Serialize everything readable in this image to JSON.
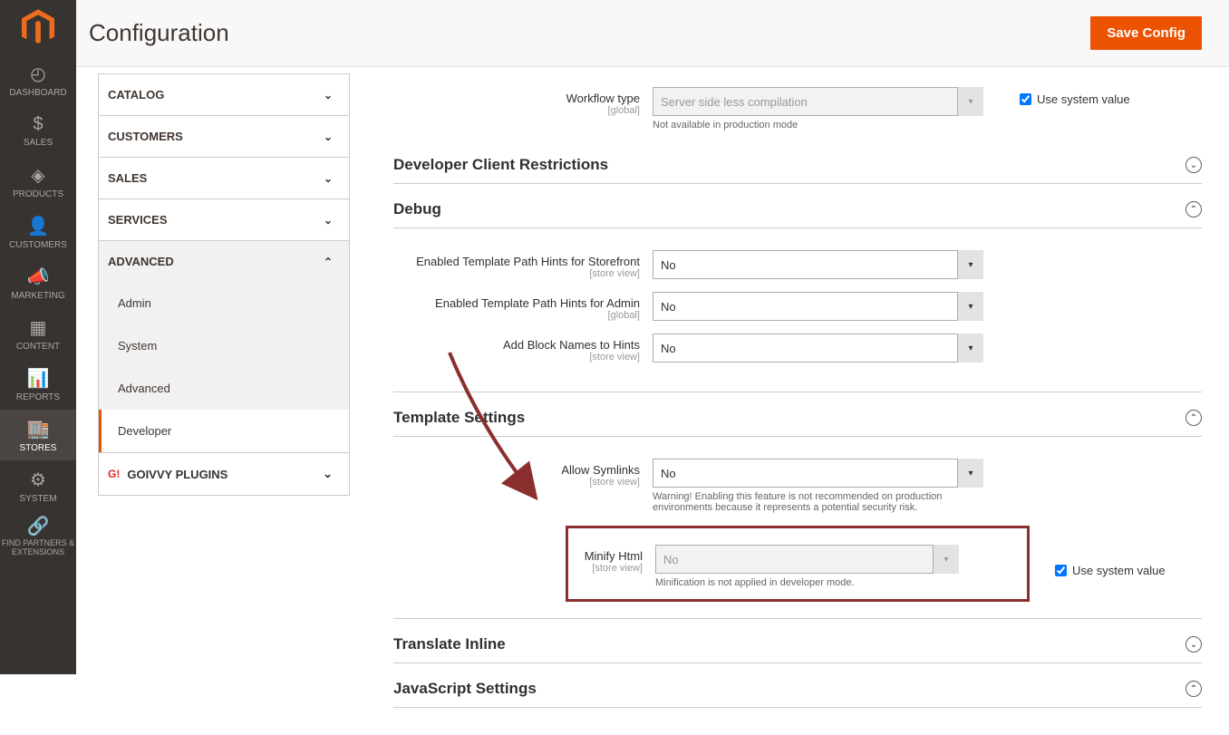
{
  "page": {
    "title": "Configuration",
    "save_button": "Save Config"
  },
  "sidebar": {
    "items": [
      {
        "label": "DASHBOARD"
      },
      {
        "label": "SALES"
      },
      {
        "label": "PRODUCTS"
      },
      {
        "label": "CUSTOMERS"
      },
      {
        "label": "MARKETING"
      },
      {
        "label": "CONTENT"
      },
      {
        "label": "REPORTS"
      },
      {
        "label": "STORES"
      },
      {
        "label": "SYSTEM"
      },
      {
        "label": "FIND PARTNERS & EXTENSIONS"
      }
    ]
  },
  "tabs": {
    "groups": [
      {
        "label": "CATALOG"
      },
      {
        "label": "CUSTOMERS"
      },
      {
        "label": "SALES"
      },
      {
        "label": "SERVICES"
      },
      {
        "label": "ADVANCED",
        "expanded": true,
        "items": [
          {
            "label": "Admin"
          },
          {
            "label": "System"
          },
          {
            "label": "Advanced"
          },
          {
            "label": "Developer",
            "active": true
          }
        ]
      },
      {
        "label": "GOIVVY PLUGINS",
        "plugins": true
      }
    ]
  },
  "workflow": {
    "label": "Workflow type",
    "scope": "[global]",
    "value": "Server side less compilation",
    "note": "Not available in production mode",
    "use_system": "Use system value"
  },
  "sections": {
    "client_restrictions": {
      "title": "Developer Client Restrictions"
    },
    "debug": {
      "title": "Debug",
      "fields": [
        {
          "label": "Enabled Template Path Hints for Storefront",
          "scope": "[store view]",
          "value": "No"
        },
        {
          "label": "Enabled Template Path Hints for Admin",
          "scope": "[global]",
          "value": "No"
        },
        {
          "label": "Add Block Names to Hints",
          "scope": "[store view]",
          "value": "No"
        }
      ]
    },
    "template": {
      "title": "Template Settings",
      "fields": [
        {
          "label": "Allow Symlinks",
          "scope": "[store view]",
          "value": "No",
          "note": "Warning! Enabling this feature is not recommended on production environments because it represents a potential security risk."
        },
        {
          "label": "Minify Html",
          "scope": "[store view]",
          "value": "No",
          "note": "Minification is not applied in developer mode.",
          "use_system": "Use system value"
        }
      ]
    },
    "translate": {
      "title": "Translate Inline"
    },
    "js": {
      "title": "JavaScript Settings"
    }
  }
}
